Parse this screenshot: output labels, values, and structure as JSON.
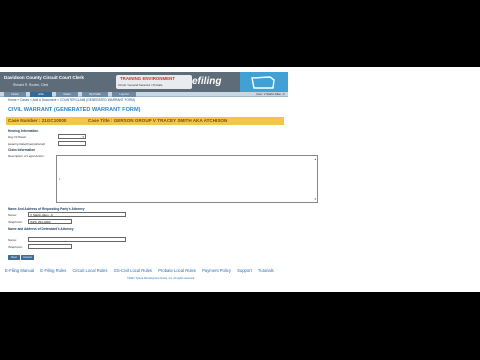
{
  "header": {
    "court_name": "Davidson County Circuit Court Clerk",
    "court_sub": "Richard R. Rooker, Clerk",
    "environment": "TRAINING ENVIRONMENT",
    "area": "Circuit / General Sessions / Probate",
    "brand": "efiling",
    "logo_icon": "tennessee-state-icon"
  },
  "nav": {
    "tabs": [
      "Home",
      "eFile",
      "Cases",
      "My Profile",
      "Log Out"
    ],
    "active_index": 1,
    "user": "User: V Starlin Allen, Jr"
  },
  "breadcrumb": [
    "Home",
    "Cases",
    "Add a Document",
    "COUNTERCLAIM (GENERATED WARRANT FORM)"
  ],
  "form": {
    "title": "CIVIL WARRANT (GENERATED WARRANT FORM)",
    "case_number": "Case Number : 21GC10000",
    "case_title": "Case Title : GERSON GROUP V TRACEY SMITH AKA ATCHISON",
    "hearing_section": "Hearing Information",
    "day_of_week_label": "Day Of Week:",
    "day_of_week_value": "",
    "hearing_datetime_label": "Hearing Date/time(optional):",
    "hearing_datetime_value": "",
    "claim_section": "Claim Information",
    "legal_action_label": "Description of Legal Action:",
    "legal_action_value": "",
    "plaintiff_attorney_section": "Name And Address of Requesting Party's Attorney",
    "pl_name_label": "Name:",
    "pl_name_value": "V Starlin Allen, Jr",
    "pl_phone_label": "Telephone:",
    "pl_phone_value": "(615) 254-4282",
    "defendant_attorney_section": "Name and Address of Defendant's Attorney",
    "def_name_label": "Name:",
    "def_name_value": "",
    "def_phone_label": "Telephone:",
    "def_phone_value": "",
    "btn_next": "Next",
    "btn_cancel": "Cancel"
  },
  "footer": {
    "links": [
      "E-Filing Manual",
      "E-Filing Rules",
      "Circuit Local Rules",
      "GS-Civil Local Rules",
      "Probate Local Rules",
      "Payment Policy",
      "Support",
      "Tutorials"
    ],
    "copyright": "2021 Tybera Development Group, Inc. All rights reserved."
  },
  "colors": {
    "header_bg": "#5e6c79",
    "title": "#2e84c8",
    "case_bar": "#f0c74a",
    "link": "#2a6db0",
    "logo_bg": "#41a0d4"
  }
}
